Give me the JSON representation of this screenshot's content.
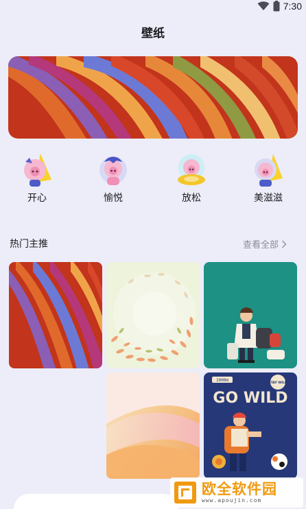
{
  "status_bar": {
    "time": "7:30",
    "wifi_icon": "wifi-icon",
    "battery_icon": "battery-icon"
  },
  "header": {
    "title": "壁纸"
  },
  "banner": {
    "icon": "abstract-ribbons-wallpaper"
  },
  "moods": [
    {
      "label": "开心",
      "icon": "happy-pig-avatar"
    },
    {
      "label": "愉悦",
      "icon": "joyful-pig-avatar"
    },
    {
      "label": "放松",
      "icon": "relax-pig-avatar"
    },
    {
      "label": "美滋滋",
      "icon": "delighted-pig-avatar"
    }
  ],
  "section": {
    "title": "热门主推",
    "see_all": "查看全部",
    "see_all_icon": "chevron-right-icon"
  },
  "wallpapers": [
    {
      "name": "ribbons",
      "icon": "abstract-ribbons-thumbnail"
    },
    {
      "name": "fish-swirl",
      "icon": "fish-swirl-thumbnail"
    },
    {
      "name": "traveler",
      "icon": "traveler-illustration-thumbnail"
    },
    {
      "name": "gradient",
      "icon": "pastel-gradient-thumbnail"
    },
    {
      "name": "go-wild",
      "icon": "go-wild-poster-thumbnail",
      "poster_title": "GO WILD",
      "poster_badge_left": "1000m",
      "poster_badge_right": "STAY WILD"
    }
  ],
  "watermark": {
    "title": "欧全软件园",
    "subtitle": "www.apoujin.com",
    "icon": "site-logo-icon"
  },
  "colors": {
    "background": "#ecedf8",
    "text": "#1b1b1f",
    "secondary_text": "#8a8c99",
    "watermark_accent": "#f09a10"
  }
}
